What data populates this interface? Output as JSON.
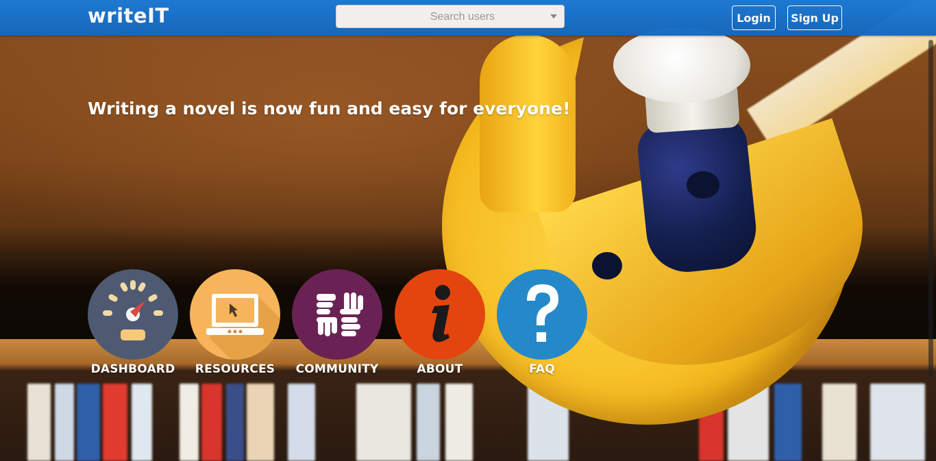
{
  "app": {
    "brand": "writeIT"
  },
  "header": {
    "search": {
      "placeholder": "Search users"
    },
    "login_label": "Login",
    "signup_label": "Sign Up"
  },
  "hero": {
    "tagline": "Writing a novel is now fun and easy for everyone!"
  },
  "tiles": [
    {
      "label": "DASHBOARD",
      "icon": "dashboard-gauge-icon",
      "color": "#4e5a72"
    },
    {
      "label": "RESOURCES",
      "icon": "laptop-cursor-icon",
      "color": "#f7b45a"
    },
    {
      "label": "COMMUNITY",
      "icon": "community-hands-icon",
      "color": "#6a2254"
    },
    {
      "label": "ABOUT",
      "icon": "info-icon",
      "color": "#e4450f"
    },
    {
      "label": "FAQ",
      "icon": "question-mark-icon",
      "color": "#2589c9"
    }
  ],
  "colors": {
    "navbar": "#1b7bd6",
    "text": "#ffffff"
  }
}
